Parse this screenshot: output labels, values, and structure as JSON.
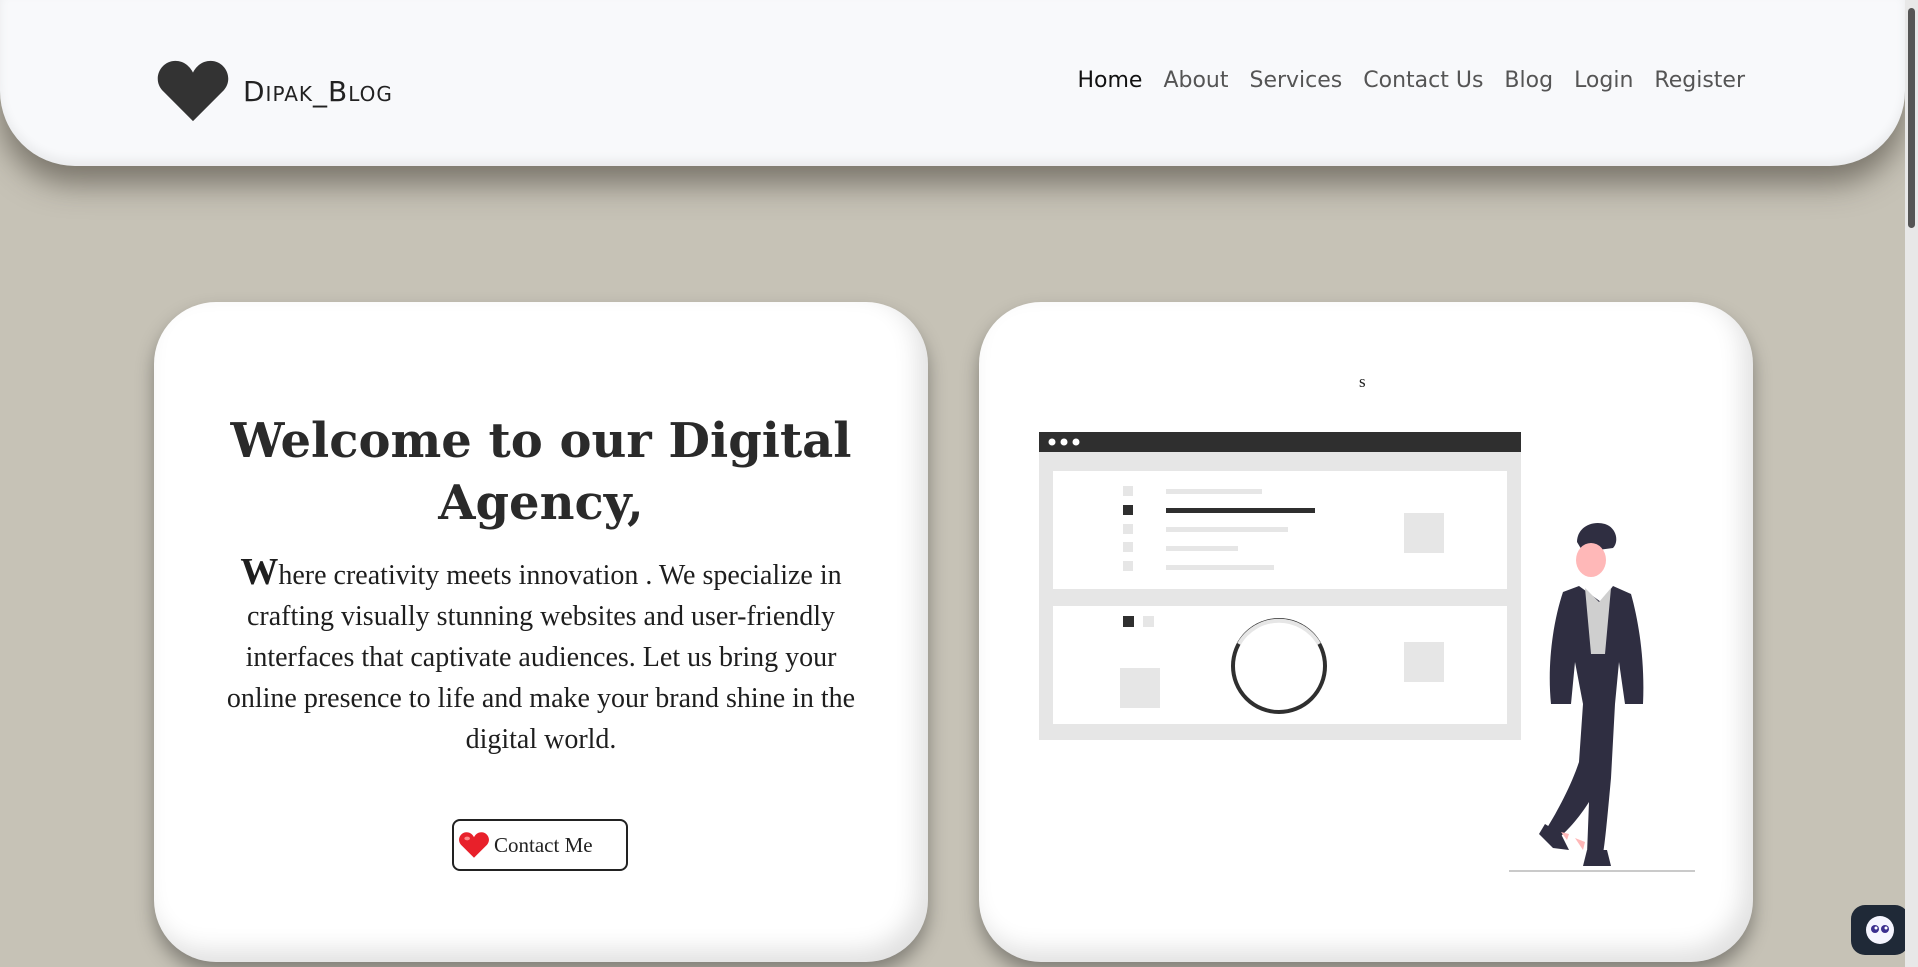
{
  "brand": {
    "name": "Dipak_Blog",
    "logo_icon": "heart-icon"
  },
  "nav": {
    "items": [
      {
        "label": "Home",
        "active": true
      },
      {
        "label": "About",
        "active": false
      },
      {
        "label": "Services",
        "active": false
      },
      {
        "label": "Contact Us",
        "active": false
      },
      {
        "label": "Blog",
        "active": false
      },
      {
        "label": "Login",
        "active": false
      },
      {
        "label": "Register",
        "active": false
      }
    ]
  },
  "hero": {
    "welcome_bold": "Welcome",
    "welcome_rest": " to our Digital Agency,",
    "lead_dropcap": "W",
    "lead_rest": "here creativity meets innovation . We specialize in crafting visually stunning websites and user-friendly interfaces that captivate audiences. Let us bring your online presence to life and make your brand shine in the digital world.",
    "contact_button": "Contact Me",
    "contact_icon": "red-heart-icon"
  },
  "illustration": {
    "caption": "s",
    "icon": "man-with-browser-window-illustration"
  },
  "colors": {
    "background": "#c6c2b6",
    "card": "#ffffff",
    "text": "#2a2a2a",
    "accent_heart": "#e8202a"
  }
}
